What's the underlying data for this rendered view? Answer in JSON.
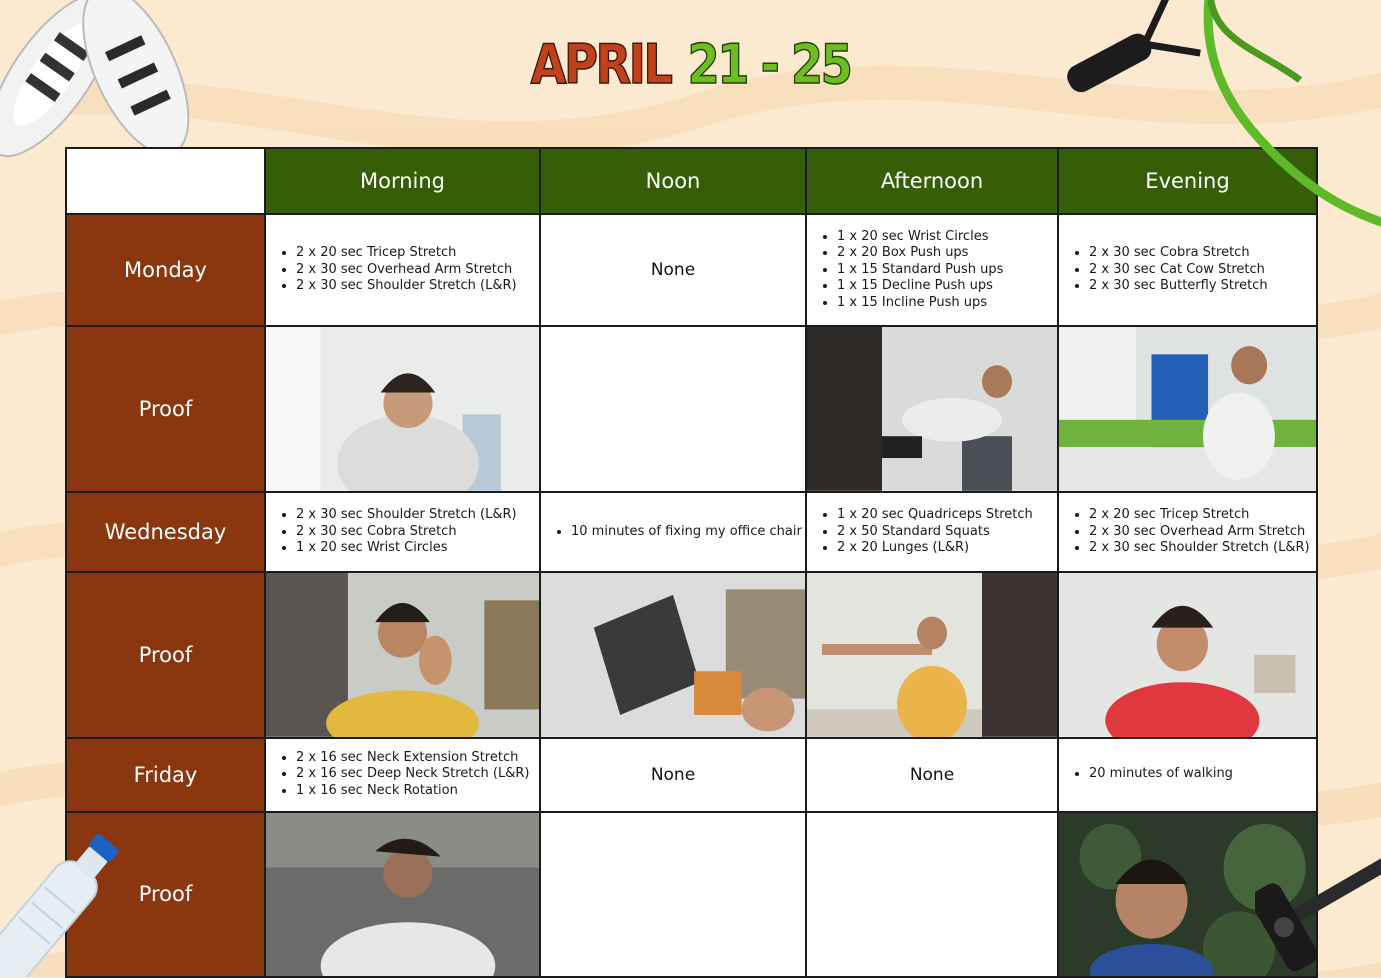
{
  "title": {
    "month": "APRIL",
    "range": "21 - 25"
  },
  "columns": [
    "Morning",
    "Noon",
    "Afternoon",
    "Evening"
  ],
  "rows": [
    {
      "label": "Monday",
      "cells": [
        {
          "items": [
            "2 x 20 sec Tricep Stretch",
            "2 x 30 sec Overhead Arm Stretch",
            "2 x 30 sec Shoulder Stretch (L&R)"
          ]
        },
        {
          "text": "None"
        },
        {
          "items": [
            "1 x 20 sec Wrist Circles",
            "2 x 20 Box Push ups",
            "1 x 15 Standard Push ups",
            "1 x 15 Decline Push ups",
            "1 x 15 Incline Push ups"
          ]
        },
        {
          "items": [
            "2 x 30 sec Cobra Stretch",
            "2 x 30 sec Cat Cow Stretch",
            "2 x 30 sec Butterfly Stretch"
          ]
        }
      ]
    },
    {
      "label": "Proof",
      "proof": [
        true,
        false,
        true,
        true
      ]
    },
    {
      "label": "Wednesday",
      "cells": [
        {
          "items": [
            "2 x 30 sec Shoulder Stretch (L&R)",
            "2 x 30 sec Cobra Stretch",
            "1 x 20 sec Wrist Circles"
          ]
        },
        {
          "items": [
            "10 minutes of fixing my office chair"
          ]
        },
        {
          "items": [
            "1 x 20 sec Quadriceps Stretch",
            "2 x 50 Standard Squats",
            "2 x 20 Lunges (L&R)"
          ]
        },
        {
          "items": [
            "2 x 20 sec Tricep Stretch",
            "2 x 30 sec Overhead Arm Stretch",
            "2 x 30 sec Shoulder Stretch (L&R)"
          ]
        }
      ]
    },
    {
      "label": "Proof",
      "proof": [
        true,
        true,
        true,
        true
      ]
    },
    {
      "label": "Friday",
      "cells": [
        {
          "items": [
            "2 x 16 sec Neck Extension Stretch",
            "2 x 16 sec Deep Neck Stretch (L&R)",
            "1 x 16 sec Neck Rotation"
          ]
        },
        {
          "text": "None"
        },
        {
          "text": "None"
        },
        {
          "items": [
            "20 minutes of walking"
          ]
        }
      ]
    },
    {
      "label": "Proof",
      "proof": [
        true,
        false,
        false,
        true
      ]
    }
  ],
  "colors": {
    "header_green": "#355e07",
    "day_brown": "#8a3710",
    "title_orange": "#c0411a",
    "title_green": "#6dbf1f",
    "background": "#fbe9d0"
  },
  "decorations": [
    "sneakers",
    "resistance-band",
    "water-bottle",
    "dumbbell"
  ]
}
